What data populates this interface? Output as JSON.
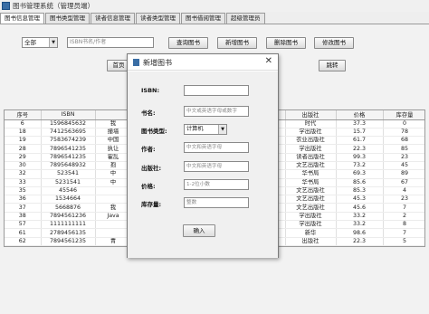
{
  "window": {
    "title": "图书管理系统（管理员端）"
  },
  "tabs": [
    "图书信息管理",
    "图书类型管理",
    "读者信息管理",
    "读者类型管理",
    "图书借阅管理",
    "超级管理员"
  ],
  "toolbar": {
    "filter_value": "全部",
    "search_placeholder": "ISBN书名/作者",
    "query_label": "查询图书",
    "add_label": "新增图书",
    "delete_label": "删除图书",
    "edit_label": "修改图书",
    "home_label": "首页",
    "jump_label": "跳转"
  },
  "table": {
    "columns": [
      "序号",
      "ISBN",
      "",
      "",
      "",
      "出版社",
      "价格",
      "库存量"
    ],
    "rows": [
      [
        "6",
        "1596845632",
        "我",
        "",
        "",
        "时代",
        "37.3",
        "0"
      ],
      [
        "18",
        "7412563695",
        "撞墙",
        "",
        "",
        "学出版社",
        "15.7",
        "78"
      ],
      [
        "19",
        "7583674239",
        "中国",
        "",
        "",
        "农业出版社",
        "61.7",
        "68"
      ],
      [
        "28",
        "7896541235",
        "执让",
        "",
        "",
        "学出版社",
        "22.3",
        "85"
      ],
      [
        "29",
        "7896541235",
        "霍乱",
        "",
        "",
        "读者出版社",
        "99.3",
        "23"
      ],
      [
        "30",
        "7895648932",
        "抱",
        "",
        "",
        "文艺出版社",
        "73.2",
        "45"
      ],
      [
        "32",
        "523541",
        "中",
        "",
        "",
        "华书局",
        "69.3",
        "89"
      ],
      [
        "33",
        "5231541",
        "中",
        "",
        "",
        "华书局",
        "85.6",
        "67"
      ],
      [
        "35",
        "45546",
        "",
        "",
        "",
        "文艺出版社",
        "85.3",
        "4"
      ],
      [
        "36",
        "1534664",
        "",
        "",
        "",
        "文艺出版社",
        "45.3",
        "23"
      ],
      [
        "37",
        "5668876",
        "我",
        "",
        "",
        "文艺出版社",
        "45.6",
        "7"
      ],
      [
        "38",
        "7894561236",
        "Java",
        "",
        "",
        "学出版社",
        "33.2",
        "2"
      ],
      [
        "57",
        "1111111111",
        "",
        "",
        "",
        "学出版社",
        "33.2",
        "8"
      ],
      [
        "61",
        "2789456135",
        "",
        "",
        "",
        "新华",
        "98.6",
        "7"
      ],
      [
        "62",
        "7894561235",
        "青",
        "",
        "",
        "出版社",
        "22.3",
        "5"
      ]
    ]
  },
  "dialog": {
    "title": "新增图书",
    "isbn_label": "ISBN:",
    "isbn_value": "",
    "bookname_label": "书名:",
    "bookname_placeholder": "中文或英语字母或数字",
    "type_label": "图书类型:",
    "type_value": "计算机",
    "author_label": "作者:",
    "author_placeholder": "中文和英语字母",
    "publisher_label": "出版社:",
    "publisher_placeholder": "中文和英语字母",
    "price_label": "价格:",
    "price_placeholder": "1-2位小数",
    "stock_label": "库存量:",
    "stock_placeholder": "整数",
    "confirm_label": "确入"
  }
}
